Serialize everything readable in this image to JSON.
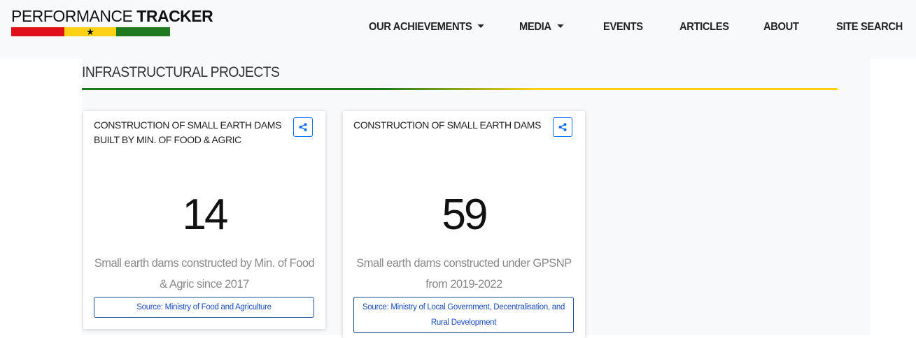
{
  "header": {
    "brand_light": "PERFORMANCE ",
    "brand_bold": "TRACKER",
    "flag_colors": [
      "#e0101b",
      "#fcd116",
      "#1f7a1f"
    ],
    "nav": [
      {
        "label": "OUR ACHIEVEMENTS",
        "dropdown": true
      },
      {
        "label": "MEDIA",
        "dropdown": true
      },
      {
        "label": "EVENTS",
        "dropdown": false
      },
      {
        "label": "ARTICLES",
        "dropdown": false
      },
      {
        "label": "ABOUT",
        "dropdown": false
      },
      {
        "label": "SITE SEARCH",
        "dropdown": false
      }
    ]
  },
  "section": {
    "title": "INFRASTRUCTURAL PROJECTS"
  },
  "cards": [
    {
      "title": "CONSTRUCTION OF SMALL EARTH DAMS BUILT BY MIN. OF FOOD & AGRIC",
      "value": "14",
      "description": "Small earth dams constructed by Min. of Food & Agric since 2017",
      "source": "Source: Ministry of Food and Agriculture",
      "share_icon": "share-icon"
    },
    {
      "title": "CONSTRUCTION OF SMALL EARTH DAMS",
      "value": "59",
      "description": "Small earth dams constructed under GPSNP from 2019-2022",
      "source": "Source: Ministry of Local Government, Decentralisation, and Rural Development",
      "share_icon": "share-icon"
    }
  ],
  "colors": {
    "accent_blue": "#0d6efd",
    "ghana_red": "#e0101b",
    "ghana_gold": "#fcd116",
    "ghana_green": "#1f7a1f"
  }
}
